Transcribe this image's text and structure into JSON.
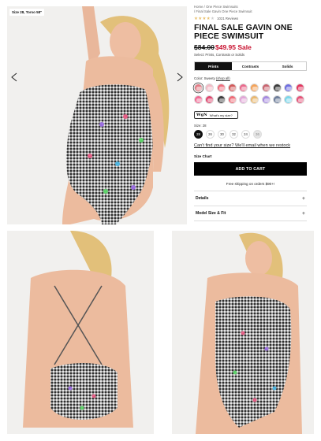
{
  "gallery": {
    "size_tag": "Size 28, Torso 58\""
  },
  "breadcrumb": {
    "items": [
      "Home",
      "One Piece Swimsuits",
      "Final Sale Gavin One Piece Swimsuit"
    ]
  },
  "rating": {
    "stars_filled": 4.5,
    "reviews": "1021 Reviews"
  },
  "product": {
    "title": "FINAL SALE GAVIN ONE PIECE SWIMSUIT",
    "old_price": "$84.00",
    "sale_price": "$49.95 Sale",
    "select_line": "Select: Prints, Contrasts or Solids"
  },
  "tabs": [
    {
      "label": "Prints",
      "active": true
    },
    {
      "label": "Contrasts",
      "active": false
    },
    {
      "label": "Solids",
      "active": false
    }
  ],
  "color": {
    "prefix": "Color:",
    "name": "Sweety",
    "shop_all": "(shop all)"
  },
  "swatches": [
    {
      "color": "#e37c86",
      "selected": true
    },
    {
      "color": "#f2b9c4",
      "selected": false
    },
    {
      "color": "#ef6e7d",
      "selected": false
    },
    {
      "color": "#d15a5a",
      "selected": false
    },
    {
      "color": "#e96a8d",
      "selected": false
    },
    {
      "color": "#f3a35a",
      "selected": false
    },
    {
      "color": "#c96570",
      "selected": false
    },
    {
      "color": "#3b3b3b",
      "selected": false
    },
    {
      "color": "#6e6ee0",
      "selected": false
    },
    {
      "color": "#e2375f",
      "selected": false
    },
    {
      "color": "#f06b94",
      "selected": false
    },
    {
      "color": "#e0476f",
      "selected": false
    },
    {
      "color": "#3d3d3d",
      "selected": false
    },
    {
      "color": "#ef6b77",
      "selected": false
    },
    {
      "color": "#e2a6d8",
      "selected": false
    },
    {
      "color": "#e9b870",
      "selected": false
    },
    {
      "color": "#a68be0",
      "selected": false
    },
    {
      "color": "#6f7f9c",
      "selected": false
    },
    {
      "color": "#7bd6ea",
      "selected": false
    },
    {
      "color": "#e6557a",
      "selected": false
    }
  ],
  "size_help": {
    "logo": "WgN",
    "text": "What's my size?"
  },
  "sizes": {
    "label": "Size: 28",
    "options": [
      {
        "label": "28",
        "state": "active"
      },
      {
        "label": "26",
        "state": "normal"
      },
      {
        "label": "30",
        "state": "normal"
      },
      {
        "label": "32",
        "state": "normal"
      },
      {
        "label": "24",
        "state": "normal"
      },
      {
        "label": "36",
        "state": "disabled"
      }
    ]
  },
  "cant_find": "Can't find your size? We'll email when we restock",
  "size_chart": "Size Chart",
  "add_to_cart": "ADD TO CART",
  "shipping": "Free shipping on orders $90+!",
  "accordion": [
    {
      "title": "Details"
    },
    {
      "title": "Model Size & Fit"
    }
  ],
  "colors": {
    "accent": "#000000",
    "sale": "#c8102e",
    "star": "#e8c06d"
  }
}
